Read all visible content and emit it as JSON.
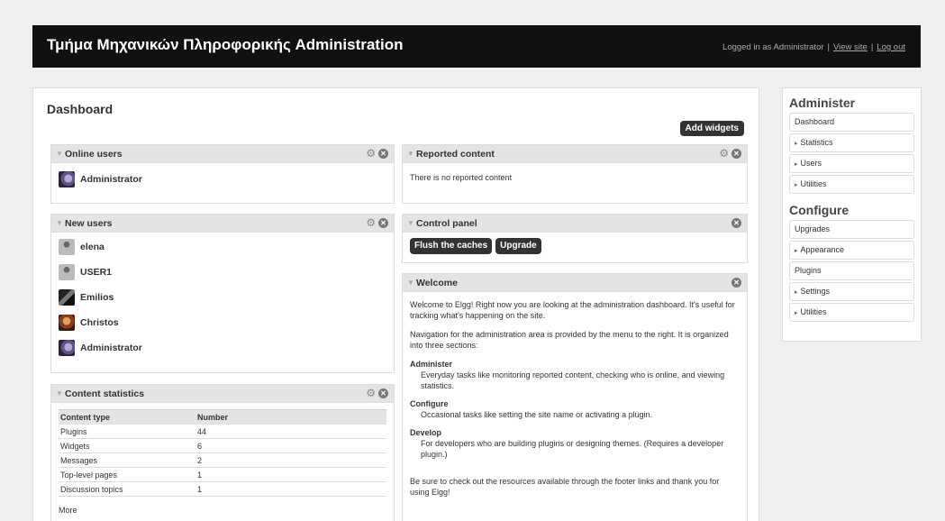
{
  "header": {
    "site_title": "Τμήμα Μηχανικών Πληροφορικής Administration",
    "logged_in_text": "Logged in as Administrator",
    "view_site": "View site",
    "log_out": "Log out",
    "separator": "|"
  },
  "dashboard": {
    "title": "Dashboard",
    "add_widgets": "Add widgets"
  },
  "online_users": {
    "title": "Online users",
    "users": [
      "Administrator"
    ]
  },
  "new_users": {
    "title": "New users",
    "users": [
      "elena",
      "USER1",
      "Emilios",
      "Christos",
      "Administrator"
    ]
  },
  "content_statistics": {
    "title": "Content statistics",
    "columns": [
      "Content type",
      "Number"
    ],
    "rows": [
      [
        "Plugins",
        "44"
      ],
      [
        "Widgets",
        "6"
      ],
      [
        "Messages",
        "2"
      ],
      [
        "Top-level pages",
        "1"
      ],
      [
        "Discussion topics",
        "1"
      ]
    ],
    "more": "More"
  },
  "reported_content": {
    "title": "Reported content",
    "empty_text": "There is no reported content"
  },
  "control_panel": {
    "title": "Control panel",
    "flush_caches": "Flush the caches",
    "upgrade": "Upgrade"
  },
  "welcome": {
    "title": "Welcome",
    "intro": "Welcome to Elgg! Right now you are looking at the administration dashboard. It's useful for tracking what's happening on the site.",
    "nav_text": "Navigation for the administration area is provided by the menu to the right. It is organized into three sections:",
    "sections": [
      {
        "term": "Administer",
        "desc": "Everyday tasks like monitoring reported content, checking who is online, and viewing statistics."
      },
      {
        "term": "Configure",
        "desc": "Occasional tasks like setting the site name or activating a plugin."
      },
      {
        "term": "Develop",
        "desc": "For developers who are building plugins or designing themes. (Requires a developer plugin.)"
      }
    ],
    "outro": "Be sure to check out the resources available through the footer links and thank you for using Elgg!"
  },
  "sidebar": {
    "administer_title": "Administer",
    "administer_items": [
      {
        "label": "Dashboard",
        "expandable": false
      },
      {
        "label": "Statistics",
        "expandable": true
      },
      {
        "label": "Users",
        "expandable": true
      },
      {
        "label": "Utilities",
        "expandable": true
      }
    ],
    "configure_title": "Configure",
    "configure_items": [
      {
        "label": "Upgrades",
        "expandable": false
      },
      {
        "label": "Appearance",
        "expandable": true
      },
      {
        "label": "Plugins",
        "expandable": false
      },
      {
        "label": "Settings",
        "expandable": true
      },
      {
        "label": "Utilities",
        "expandable": true
      }
    ]
  },
  "colors": {
    "header_bg": "#111111",
    "button_bg": "#333333",
    "widget_head_bg": "#e4e4e4"
  }
}
